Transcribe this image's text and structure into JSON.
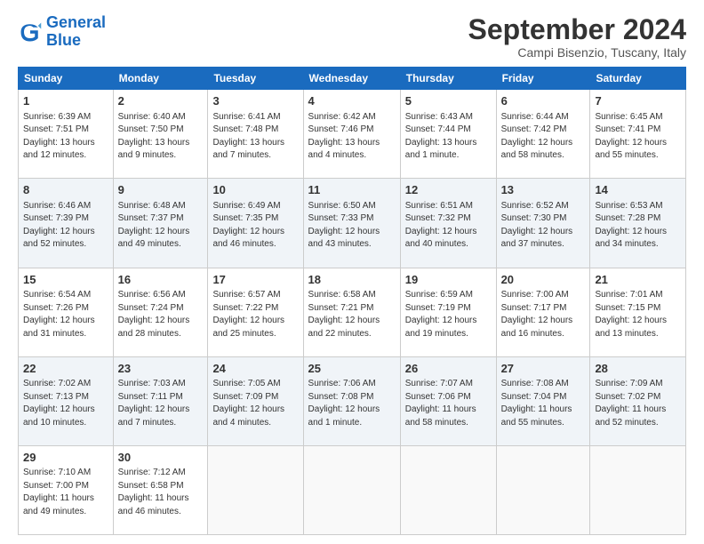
{
  "logo": {
    "line1": "General",
    "line2": "Blue"
  },
  "title": "September 2024",
  "subtitle": "Campi Bisenzio, Tuscany, Italy",
  "days": [
    "Sunday",
    "Monday",
    "Tuesday",
    "Wednesday",
    "Thursday",
    "Friday",
    "Saturday"
  ],
  "weeks": [
    [
      {
        "day": 1,
        "sunrise": "6:39 AM",
        "sunset": "7:51 PM",
        "daylight": "13 hours and 12 minutes."
      },
      {
        "day": 2,
        "sunrise": "6:40 AM",
        "sunset": "7:50 PM",
        "daylight": "13 hours and 9 minutes."
      },
      {
        "day": 3,
        "sunrise": "6:41 AM",
        "sunset": "7:48 PM",
        "daylight": "13 hours and 7 minutes."
      },
      {
        "day": 4,
        "sunrise": "6:42 AM",
        "sunset": "7:46 PM",
        "daylight": "13 hours and 4 minutes."
      },
      {
        "day": 5,
        "sunrise": "6:43 AM",
        "sunset": "7:44 PM",
        "daylight": "13 hours and 1 minute."
      },
      {
        "day": 6,
        "sunrise": "6:44 AM",
        "sunset": "7:42 PM",
        "daylight": "12 hours and 58 minutes."
      },
      {
        "day": 7,
        "sunrise": "6:45 AM",
        "sunset": "7:41 PM",
        "daylight": "12 hours and 55 minutes."
      }
    ],
    [
      {
        "day": 8,
        "sunrise": "6:46 AM",
        "sunset": "7:39 PM",
        "daylight": "12 hours and 52 minutes."
      },
      {
        "day": 9,
        "sunrise": "6:48 AM",
        "sunset": "7:37 PM",
        "daylight": "12 hours and 49 minutes."
      },
      {
        "day": 10,
        "sunrise": "6:49 AM",
        "sunset": "7:35 PM",
        "daylight": "12 hours and 46 minutes."
      },
      {
        "day": 11,
        "sunrise": "6:50 AM",
        "sunset": "7:33 PM",
        "daylight": "12 hours and 43 minutes."
      },
      {
        "day": 12,
        "sunrise": "6:51 AM",
        "sunset": "7:32 PM",
        "daylight": "12 hours and 40 minutes."
      },
      {
        "day": 13,
        "sunrise": "6:52 AM",
        "sunset": "7:30 PM",
        "daylight": "12 hours and 37 minutes."
      },
      {
        "day": 14,
        "sunrise": "6:53 AM",
        "sunset": "7:28 PM",
        "daylight": "12 hours and 34 minutes."
      }
    ],
    [
      {
        "day": 15,
        "sunrise": "6:54 AM",
        "sunset": "7:26 PM",
        "daylight": "12 hours and 31 minutes."
      },
      {
        "day": 16,
        "sunrise": "6:56 AM",
        "sunset": "7:24 PM",
        "daylight": "12 hours and 28 minutes."
      },
      {
        "day": 17,
        "sunrise": "6:57 AM",
        "sunset": "7:22 PM",
        "daylight": "12 hours and 25 minutes."
      },
      {
        "day": 18,
        "sunrise": "6:58 AM",
        "sunset": "7:21 PM",
        "daylight": "12 hours and 22 minutes."
      },
      {
        "day": 19,
        "sunrise": "6:59 AM",
        "sunset": "7:19 PM",
        "daylight": "12 hours and 19 minutes."
      },
      {
        "day": 20,
        "sunrise": "7:00 AM",
        "sunset": "7:17 PM",
        "daylight": "12 hours and 16 minutes."
      },
      {
        "day": 21,
        "sunrise": "7:01 AM",
        "sunset": "7:15 PM",
        "daylight": "12 hours and 13 minutes."
      }
    ],
    [
      {
        "day": 22,
        "sunrise": "7:02 AM",
        "sunset": "7:13 PM",
        "daylight": "12 hours and 10 minutes."
      },
      {
        "day": 23,
        "sunrise": "7:03 AM",
        "sunset": "7:11 PM",
        "daylight": "12 hours and 7 minutes."
      },
      {
        "day": 24,
        "sunrise": "7:05 AM",
        "sunset": "7:09 PM",
        "daylight": "12 hours and 4 minutes."
      },
      {
        "day": 25,
        "sunrise": "7:06 AM",
        "sunset": "7:08 PM",
        "daylight": "12 hours and 1 minute."
      },
      {
        "day": 26,
        "sunrise": "7:07 AM",
        "sunset": "7:06 PM",
        "daylight": "11 hours and 58 minutes."
      },
      {
        "day": 27,
        "sunrise": "7:08 AM",
        "sunset": "7:04 PM",
        "daylight": "11 hours and 55 minutes."
      },
      {
        "day": 28,
        "sunrise": "7:09 AM",
        "sunset": "7:02 PM",
        "daylight": "11 hours and 52 minutes."
      }
    ],
    [
      {
        "day": 29,
        "sunrise": "7:10 AM",
        "sunset": "7:00 PM",
        "daylight": "11 hours and 49 minutes."
      },
      {
        "day": 30,
        "sunrise": "7:12 AM",
        "sunset": "6:58 PM",
        "daylight": "11 hours and 46 minutes."
      },
      null,
      null,
      null,
      null,
      null
    ]
  ]
}
